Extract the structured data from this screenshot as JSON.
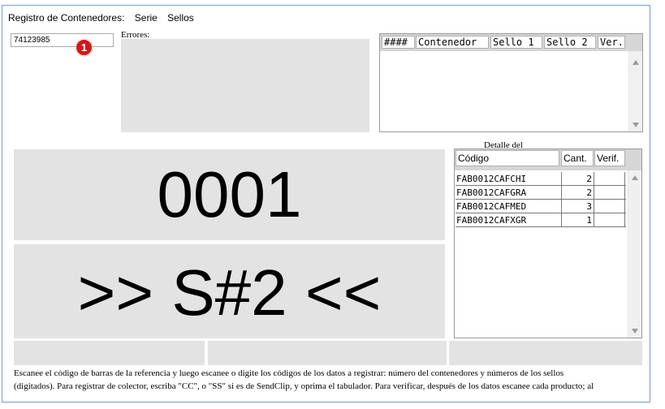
{
  "menu": {
    "title": "Registro de Contenedores:",
    "serie": "Serie",
    "sellos": "Sellos"
  },
  "code_input": {
    "value": "74123985"
  },
  "badge": {
    "number": "1",
    "color": "#d01919"
  },
  "errors": {
    "label": "Errores:"
  },
  "containers_list": {
    "columns": [
      "####",
      "Contenedor",
      "Sello 1",
      "Sello 2",
      "Ver."
    ],
    "rows": []
  },
  "counter": {
    "value": "0001"
  },
  "slot": {
    "value": ">> S#2 <<"
  },
  "detail": {
    "label": "Detalle del",
    "columns": [
      "Código",
      "Cant.",
      "Verif."
    ],
    "rows": [
      {
        "code": "FAB0012CAFCHI",
        "qty": "2",
        "verif": ""
      },
      {
        "code": "FAB0012CAFGRA",
        "qty": "2",
        "verif": ""
      },
      {
        "code": "FAB0012CAFMED",
        "qty": "3",
        "verif": ""
      },
      {
        "code": "FAB0012CAFXGR",
        "qty": "1",
        "verif": ""
      }
    ]
  },
  "instructions": {
    "line1": "Escanee el código de barras de la referencia y luego escanee o digite los códigos de los datos a registrar: número del contenedores y números de los sellos",
    "line2": "(digitados). Para registrar de colector, escriba \"CC\", o \"SS\" si es de SendClip, y oprima el tabulador. Para verificar, después de los datos escanee cada producto; al"
  },
  "colors": {
    "panel_gray": "#e3e3e3",
    "header_gray": "#d6d6d6",
    "window_border": "#7a9cc6"
  }
}
